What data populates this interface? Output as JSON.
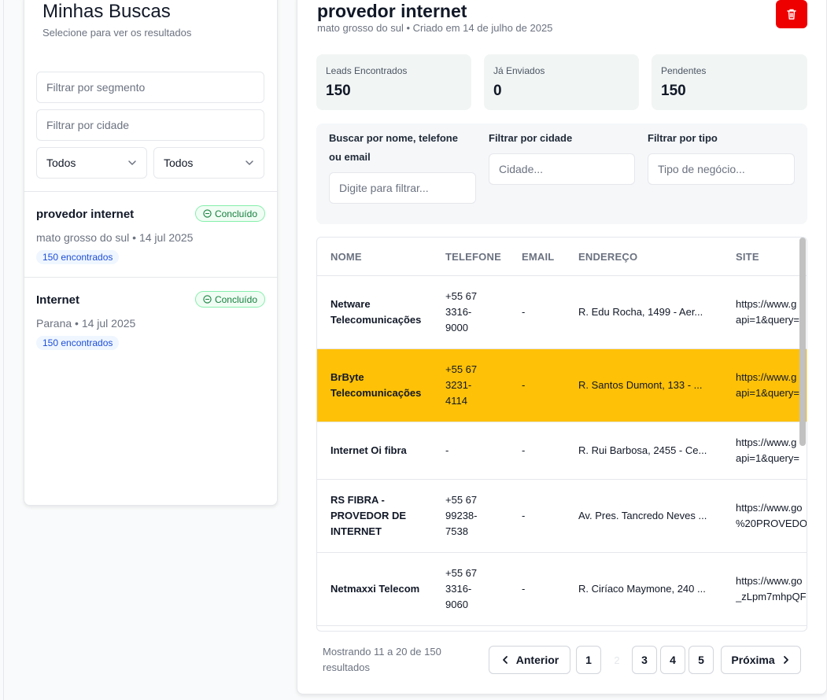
{
  "sidebar": {
    "title": "Minhas Buscas",
    "subtitle": "Selecione para ver os resultados",
    "segment_placeholder": "Filtrar por segmento",
    "city_placeholder": "Filtrar por cidade",
    "select1": "Todos",
    "select2": "Todos",
    "searches": [
      {
        "name": "provedor internet",
        "status": "Concluído",
        "meta": "mato grosso do sul • 14 jul 2025",
        "count": "150 encontrados"
      },
      {
        "name": "Internet",
        "status": "Concluído",
        "meta": "Parana • 14 jul 2025",
        "count": "150 encontrados"
      }
    ]
  },
  "detail": {
    "title": "provedor internet",
    "subtitle": "mato grosso do sul • Criado em 14 de julho de 2025",
    "stats": [
      {
        "label": "Leads Encontrados",
        "value": "150"
      },
      {
        "label": "Já Enviados",
        "value": "0"
      },
      {
        "label": "Pendentes",
        "value": "150"
      }
    ],
    "filters": {
      "name_label": "Buscar por nome, telefone ou email",
      "name_placeholder": "Digite para filtrar...",
      "city_label": "Filtrar por cidade",
      "city_placeholder": "Cidade...",
      "type_label": "Filtrar por tipo",
      "type_placeholder": "Tipo de negócio..."
    }
  },
  "table": {
    "headers": [
      "NOME",
      "TELEFONE",
      "EMAIL",
      "ENDEREÇO",
      "SITE"
    ],
    "rows": [
      {
        "name": "Netware Telecomunicações",
        "phone": "+55 67\n3316-\n9000",
        "email": "-",
        "address": "R. Edu Rocha, 1499 - Aer...",
        "site": "https://www.g\napi=1&query="
      },
      {
        "name": "BrByte Telecomunicações",
        "phone": "+55 67\n3231-\n4114",
        "email": "-",
        "address": "R. Santos Dumont, 133 - ...",
        "site": "https://www.g\napi=1&query="
      },
      {
        "name": "Internet Oi fibra",
        "phone": "-",
        "email": "-",
        "address": "R. Rui Barbosa, 2455 - Ce...",
        "site": "https://www.g\napi=1&query="
      },
      {
        "name": "RS FIBRA - PROVEDOR DE INTERNET",
        "phone": "+55 67\n99238-\n7538",
        "email": "-",
        "address": "Av. Pres. Tancredo Neves ...",
        "site": "https://www.go\n%20PROVEDO"
      },
      {
        "name": "Netmaxxi Telecom",
        "phone": "+55 67\n3316-\n9060",
        "email": "-",
        "address": "R. Ciríaco Maymone, 240 ...",
        "site": "https://www.go\n_zLpm7mhpQF"
      }
    ]
  },
  "pagination": {
    "summary": "Mostrando 11 a 20 de 150 resultados",
    "prev": "Anterior",
    "next": "Próxima",
    "pages": [
      "1",
      "2",
      "3",
      "4",
      "5"
    ],
    "current": "2"
  },
  "colors": {
    "highlight": "#ffc107",
    "delete": "#ef0000",
    "success": "#15803d"
  }
}
